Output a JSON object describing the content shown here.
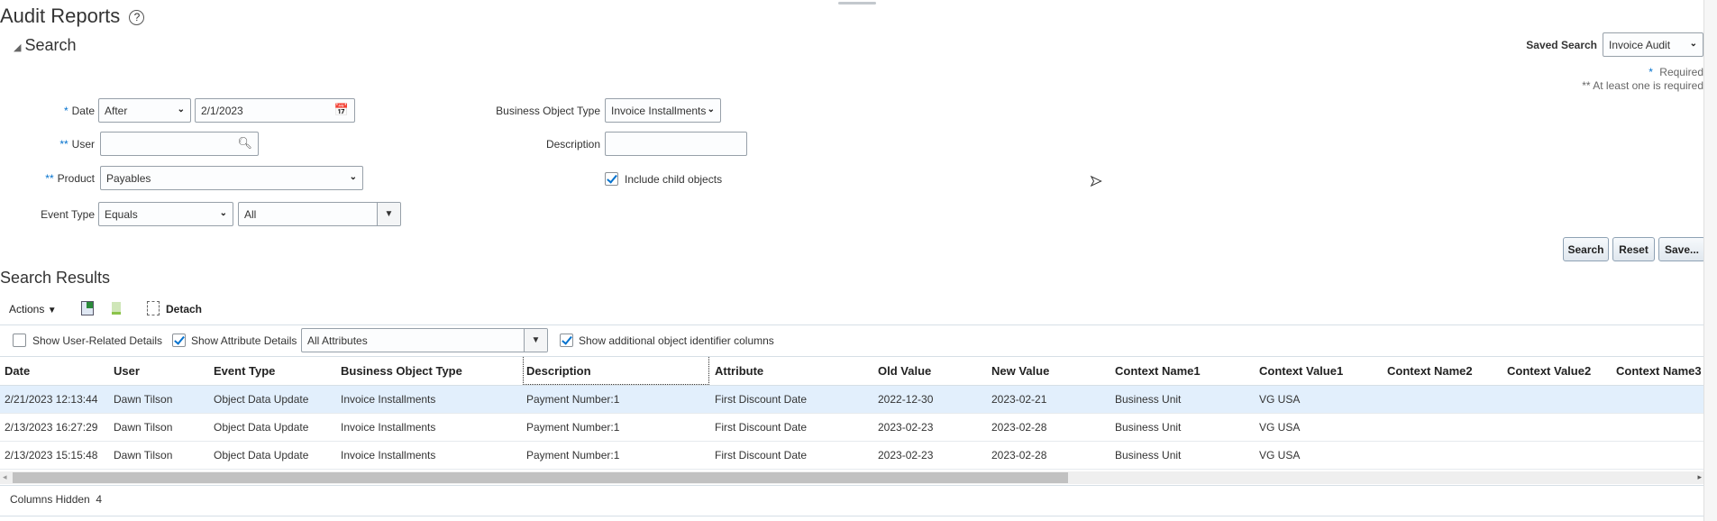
{
  "page": {
    "title": "Audit Reports",
    "help_icon": "?"
  },
  "search": {
    "section_title": "Search",
    "saved_search_label": "Saved Search",
    "saved_search_value": "Invoice Audit",
    "required_note": "Required",
    "required_mark": "*",
    "at_least_one_note": "** At least one is required",
    "date": {
      "mark": "*",
      "label": "Date",
      "operator": "After",
      "value": "2/1/2023"
    },
    "user": {
      "mark": "**",
      "label": "User",
      "value": ""
    },
    "product": {
      "mark": "**",
      "label": "Product",
      "value": "Payables"
    },
    "event_type": {
      "label": "Event Type",
      "operator": "Equals",
      "value": "All"
    },
    "business_object_type": {
      "label": "Business Object Type",
      "value": "Invoice Installments"
    },
    "description": {
      "label": "Description",
      "value": ""
    },
    "include_child": {
      "label": "Include child objects",
      "checked": true
    },
    "buttons": {
      "search": "Search",
      "reset": "Reset",
      "save": "Save..."
    }
  },
  "results": {
    "title": "Search Results",
    "toolbar": {
      "actions": "Actions",
      "detach": "Detach"
    },
    "filters": {
      "show_user_details": {
        "label": "Show User-Related Details",
        "checked": false
      },
      "show_attribute_details": {
        "label": "Show Attribute Details",
        "checked": true
      },
      "attributes_value": "All Attributes",
      "show_additional": {
        "label": "Show additional object identifier columns",
        "checked": true
      }
    },
    "columns": [
      "Date",
      "User",
      "Event Type",
      "Business Object Type",
      "Description",
      "Attribute",
      "Old Value",
      "New Value",
      "Context Name1",
      "Context Value1",
      "Context Name2",
      "Context Value2",
      "Context Name3"
    ],
    "rows": [
      [
        "2/21/2023 12:13:44",
        "Dawn Tilson",
        "Object Data Update",
        "Invoice Installments",
        "Payment Number:1",
        "First Discount Date",
        "2022-12-30",
        "2023-02-21",
        "Business Unit",
        "VG USA",
        "",
        "",
        ""
      ],
      [
        "2/13/2023 16:27:29",
        "Dawn Tilson",
        "Object Data Update",
        "Invoice Installments",
        "Payment Number:1",
        "First Discount Date",
        "2023-02-23",
        "2023-02-28",
        "Business Unit",
        "VG USA",
        "",
        "",
        ""
      ],
      [
        "2/13/2023 15:15:48",
        "Dawn Tilson",
        "Object Data Update",
        "Invoice Installments",
        "Payment Number:1",
        "First Discount Date",
        "2023-02-23",
        "2023-02-28",
        "Business Unit",
        "VG USA",
        "",
        "",
        ""
      ]
    ],
    "columns_hidden_label": "Columns Hidden",
    "columns_hidden_count": "4"
  }
}
